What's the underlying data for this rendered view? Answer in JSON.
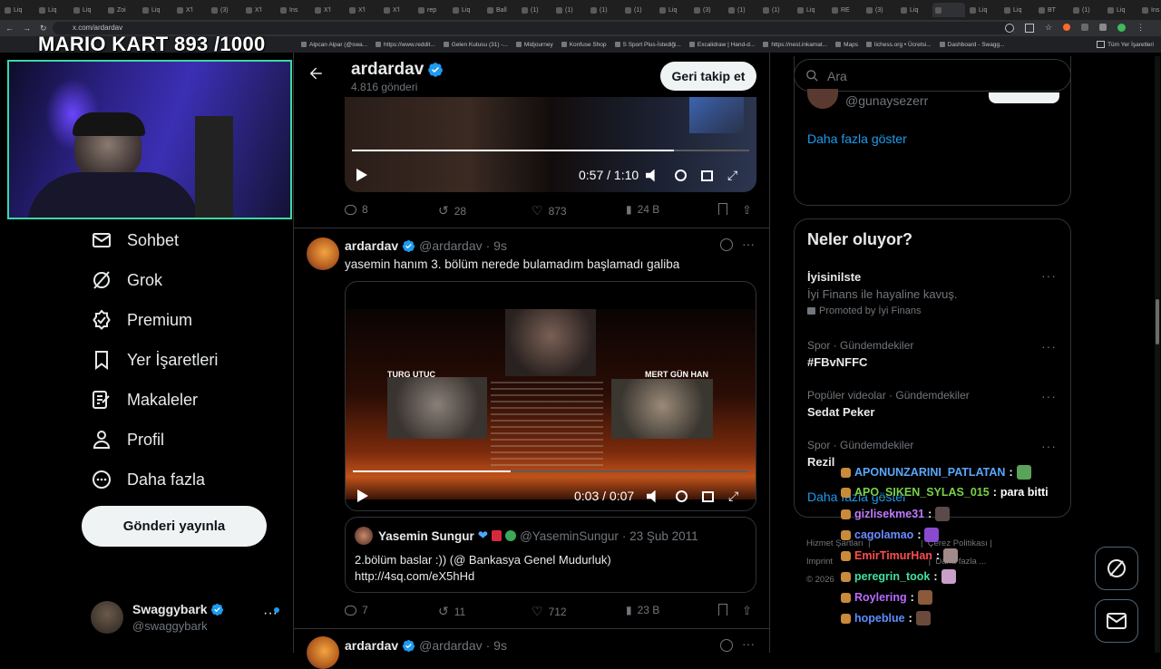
{
  "browser": {
    "tabs": [
      "Liq",
      "Liq",
      "Liq",
      "Zoi",
      "Liq",
      "X'l",
      "(3)",
      "X'l",
      "Ins",
      "X'l",
      "X'l",
      "X'l",
      "rep",
      "Liq",
      "Ball",
      "(1)",
      "(1)",
      "(1)",
      "(1)",
      "Liq",
      "(3)",
      "(1)",
      "(1)",
      "Liq",
      "RE",
      "(3)",
      "Liq",
      "",
      "Liq",
      "Liq",
      "BT",
      "(1)",
      "Liq",
      "Ins",
      "Bu",
      "Liq",
      "xc"
    ],
    "url": "x.com/ardardav",
    "bookmarks": [
      "Alpcan Alpar (@swa...",
      "https://www.reddit...",
      "Gelen Kutusu (31) -...",
      "Midjourney",
      "Konfuse Shop",
      "S Sport Plus-İstediği...",
      "Excalidraw | Hand-d...",
      "https://nest.inkamat...",
      "Maps",
      "lichess.org • Ücretsi...",
      "Dashboard - Swagg..."
    ],
    "all_bookmarks": "Tüm Yer İşaretleri"
  },
  "overlay": {
    "title": "MARIO KART   893 /1000"
  },
  "nav": {
    "items": [
      {
        "label": "Sohbet",
        "icon": "mail-icon"
      },
      {
        "label": "Grok",
        "icon": "grok-icon"
      },
      {
        "label": "Premium",
        "icon": "premium-icon"
      },
      {
        "label": "Yer İşaretleri",
        "icon": "bookmark-icon"
      },
      {
        "label": "Makaleler",
        "icon": "articles-icon"
      },
      {
        "label": "Profil",
        "icon": "profile-icon"
      },
      {
        "label": "Daha fazla",
        "icon": "more-circle-icon"
      }
    ],
    "post_button": "Gönderi yayınla",
    "account": {
      "name": "Swaggybark",
      "handle": "@swaggybark"
    }
  },
  "profile_header": {
    "name": "ardardav",
    "posts": "4.816 gönderi",
    "follow_back": "Geri takip et"
  },
  "tweet1": {
    "video_time": "0:57 / 1:10",
    "video_progress": 0.81,
    "replies": "8",
    "retweets": "28",
    "likes": "873",
    "views": "24 B"
  },
  "tweet2": {
    "name": "ardardav",
    "handle": "@ardardav",
    "time": "· 9s",
    "text": "yasemin hanım 3. bölüm nerede bulamadım başlamadı galiba",
    "video_time": "0:03 / 0:07",
    "video_progress": 0.4,
    "video_labels": {
      "left": "TURG UTUC",
      "right": "MERT GÜN HAN"
    },
    "quote": {
      "name": "Yasemin Sungur",
      "handle": "@YaseminSungur",
      "date": "· 23 Şub 2011",
      "text": "2.bölüm baslar :)) (@ Bankasya Genel Mudurluk)",
      "link": "http://4sq.com/eX5hHd"
    },
    "replies": "7",
    "retweets": "11",
    "likes": "712",
    "views": "23 B"
  },
  "tweet3": {
    "name": "ardardav",
    "handle": "@ardardav",
    "time": "· 9s"
  },
  "right": {
    "search_placeholder": "Ara",
    "follow_suggestion_handle": "@gunaysezerr",
    "show_more": "Daha fazla göster",
    "trends_title": "Neler oluyor?",
    "trends": [
      {
        "meta": "İyisinilste",
        "title": "İyi Finans ile hayaline kavuş.",
        "promo": "Promoted by İyi Finans"
      },
      {
        "meta": "Spor · Gündemdekiler",
        "title": "#FBvNFFC"
      },
      {
        "meta": "Popüler videolar · Gündemdekiler",
        "title": "Sedat Peker"
      },
      {
        "meta": "Spor · Gündemdekiler",
        "title": "Rezil"
      }
    ],
    "trends_more": "Daha fazla göster",
    "footer": [
      "Hizmet Şartları",
      "Çerez Politikası",
      "Imprint",
      "Daha fazla ...",
      "© 2026"
    ]
  },
  "chat": [
    {
      "user": "APONUNZARINI_PATLATAN",
      "color": "#5aa7ff",
      "msg": ""
    },
    {
      "user": "APO_SIKEN_SYLAS_015",
      "color": "#7ad14a",
      "msg": "para bitti"
    },
    {
      "user": "gizlisekme31",
      "color": "#c07bff",
      "msg": ""
    },
    {
      "user": "cagolamao",
      "color": "#6b8cff",
      "msg": ""
    },
    {
      "user": "EmirTimurHan",
      "color": "#ff4d4d",
      "msg": ""
    },
    {
      "user": "peregrin_took",
      "color": "#41e0a0",
      "msg": ""
    },
    {
      "user": "Roylering",
      "color": "#b76bff",
      "msg": ""
    },
    {
      "user": "hopeblue",
      "color": "#5b8dff",
      "msg": ""
    }
  ],
  "colors": {
    "accent": "#1d9bf0",
    "cam_border": "#3fd7a4"
  }
}
